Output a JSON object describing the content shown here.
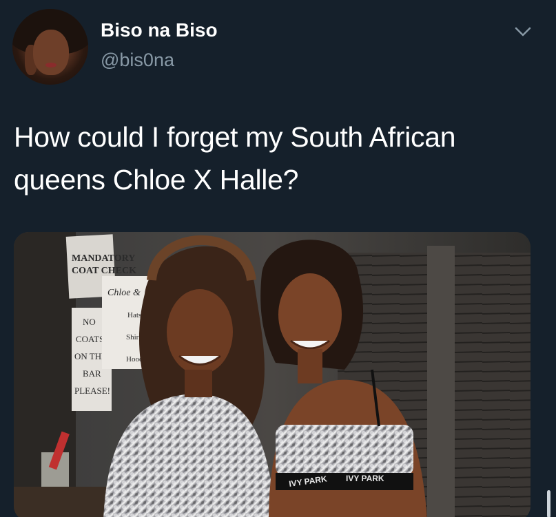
{
  "tweet": {
    "display_name": "Biso na Biso",
    "handle": "@bis0na",
    "text": "How could I forget my South African queens Chloe X Halle?",
    "avatar_icon": "user-avatar",
    "menu_icon": "chevron-down-icon"
  },
  "media": {
    "sign_mandatory": [
      "MANDATORY",
      "COAT CHECK"
    ],
    "sign_no_coats": [
      "NO",
      "COATS",
      "ON THE",
      "BAR",
      "PLEASE!"
    ],
    "sign_list_title": "Chloe &",
    "sign_list_items": [
      "Hats ...",
      "Shirts...",
      "Hoodie"
    ],
    "band_left": "IVY PARK",
    "band_right": "IVY PARK"
  },
  "colors": {
    "background": "#15202b",
    "secondary_text": "#8899a6",
    "primary_text": "#ffffff"
  }
}
